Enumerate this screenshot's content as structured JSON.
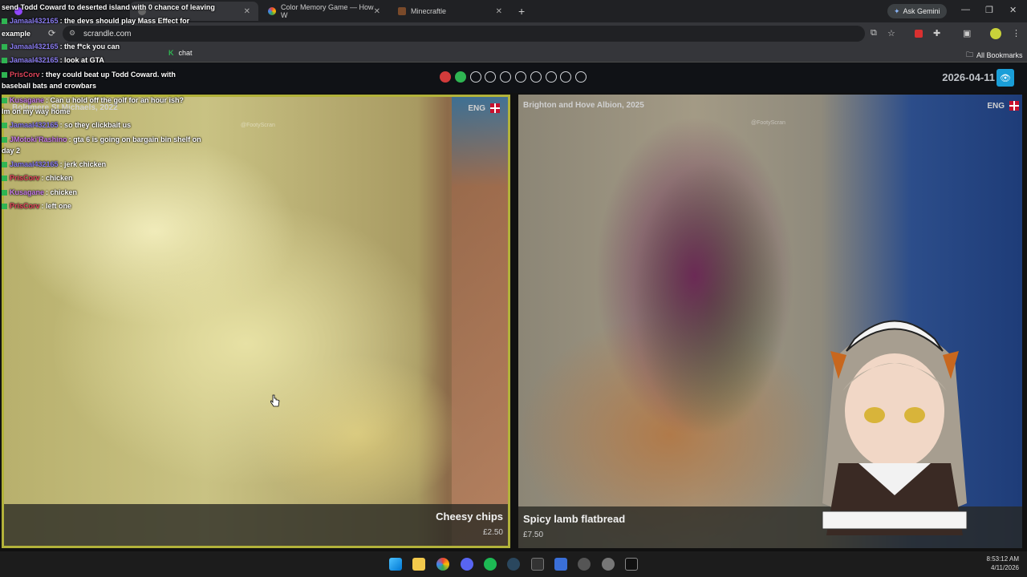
{
  "browser": {
    "tabs": [
      {
        "label": "",
        "active": false
      },
      {
        "label": "",
        "active": true
      },
      {
        "label": "Color Memory Game — How W",
        "active": false
      },
      {
        "label": "Minecraftle",
        "active": false
      }
    ],
    "new_tab": "+",
    "gemini_button": "Ask Gemini",
    "url": "scrandle.com",
    "bookmark_chat": "chat",
    "all_bookmarks": "All Bookmarks"
  },
  "game": {
    "date": "2026-04-11",
    "progress_dots": [
      "red",
      "green",
      "empty",
      "empty",
      "empty",
      "empty",
      "empty",
      "empty",
      "empty",
      "empty"
    ]
  },
  "cards": [
    {
      "location": "Boldmere St Michaels, 2022",
      "lang": "ENG",
      "watermark": "@FootyScran",
      "dish": "Cheesy chips",
      "price": "£2.50"
    },
    {
      "location": "Brighton and Hove Albion, 2025",
      "lang": "ENG",
      "watermark": "@FootyScran",
      "dish": "Spicy lamb flatbread",
      "price": "£7.50"
    }
  ],
  "chat": [
    {
      "user": "",
      "text": "send Todd Coward to deserted island with 0 chance of leaving",
      "color": "#ffffff"
    },
    {
      "user": "Jamaal432165",
      "text": ": the devs should play Mass Effect for",
      "color": "#8a7cf0"
    },
    {
      "user": "",
      "text": "example",
      "color": "#ffffff"
    },
    {
      "user": "Jamaal432165",
      "text": ": the f*ck you can",
      "color": "#8a7cf0"
    },
    {
      "user": "Jamaal432165",
      "text": ": look at GTA",
      "color": "#8a7cf0"
    },
    {
      "user": "PrisCorv",
      "text": ": they could beat up Todd Coward. with",
      "color": "#e0455b"
    },
    {
      "user": "",
      "text": "baseball bats and crowbars",
      "color": "#ffffff"
    },
    {
      "user": "Kusagane",
      "text": ": Can u hold off the golf for an hour ish?",
      "color": "#c77ce8"
    },
    {
      "user": "",
      "text": "Im on my way home",
      "color": "#ffffff"
    },
    {
      "user": "Jamaal432165",
      "text": ": so they clickbait us",
      "color": "#8a7cf0"
    },
    {
      "user": "JMotoki'Rashino",
      "text": ": gta 6 is going on bargain bin shelf on",
      "color": "#c77ce8"
    },
    {
      "user": "",
      "text": "day 2",
      "color": "#ffffff"
    },
    {
      "user": "Jamaal432165",
      "text": ": jerk chicken",
      "color": "#8a7cf0"
    },
    {
      "user": "PrisCorv",
      "text": ": chicken",
      "color": "#e0455b"
    },
    {
      "user": "Kusagane",
      "text": ": chicken",
      "color": "#c77ce8"
    },
    {
      "user": "PrisCorv",
      "text": ": left one",
      "color": "#e0455b"
    }
  ],
  "taskbar": {
    "time": "8:53:12 AM",
    "date": "4/11/2026"
  }
}
